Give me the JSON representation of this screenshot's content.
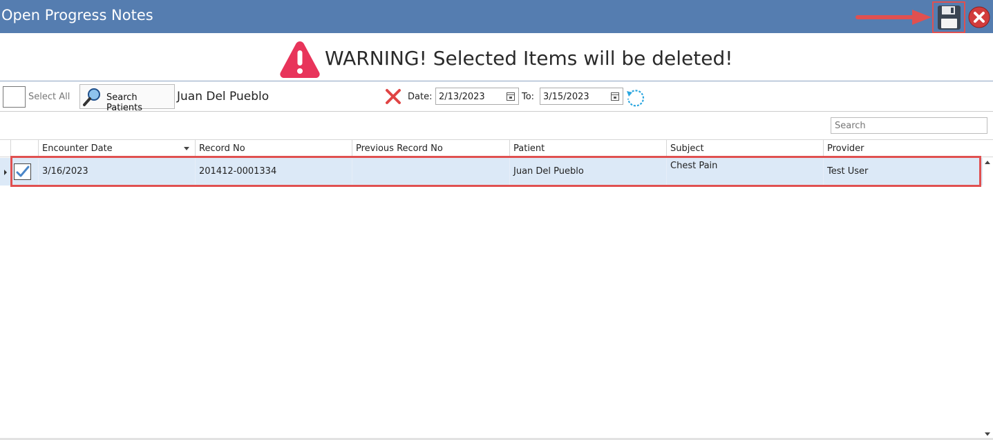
{
  "window": {
    "title": "Open Progress Notes"
  },
  "colors": {
    "titlebar": "#557db0",
    "warning_icon": "#e8345a",
    "annotation": "#e05050",
    "row_selected": "#dce9f7"
  },
  "toolbar_icons": {
    "save": "floppy-disk-icon",
    "close": "close-icon",
    "annotation_arrow": "arrow-right-icon"
  },
  "warning": {
    "message": "WARNING! Selected Items will be deleted!",
    "icon": "warning-triangle-icon"
  },
  "filters": {
    "select_all_label": "Select All",
    "search_patients_label": "Search Patients",
    "patient_name": "Juan Del Pueblo",
    "date_label": "Date:",
    "date_from": "2/13/2023",
    "to_label": "To:",
    "date_to": "3/15/2023"
  },
  "grid": {
    "search_placeholder": "Search",
    "columns": [
      "Encounter Date",
      "Record No",
      "Previous Record No",
      "Patient",
      "Subject",
      "Provider"
    ],
    "sort_column": "Encounter Date",
    "rows": [
      {
        "checked": true,
        "encounter_date": "3/16/2023",
        "record_no": "201412-0001334",
        "previous_record_no": "",
        "patient": "Juan Del Pueblo",
        "subject": "Chest Pain",
        "provider": "Test User"
      }
    ]
  }
}
